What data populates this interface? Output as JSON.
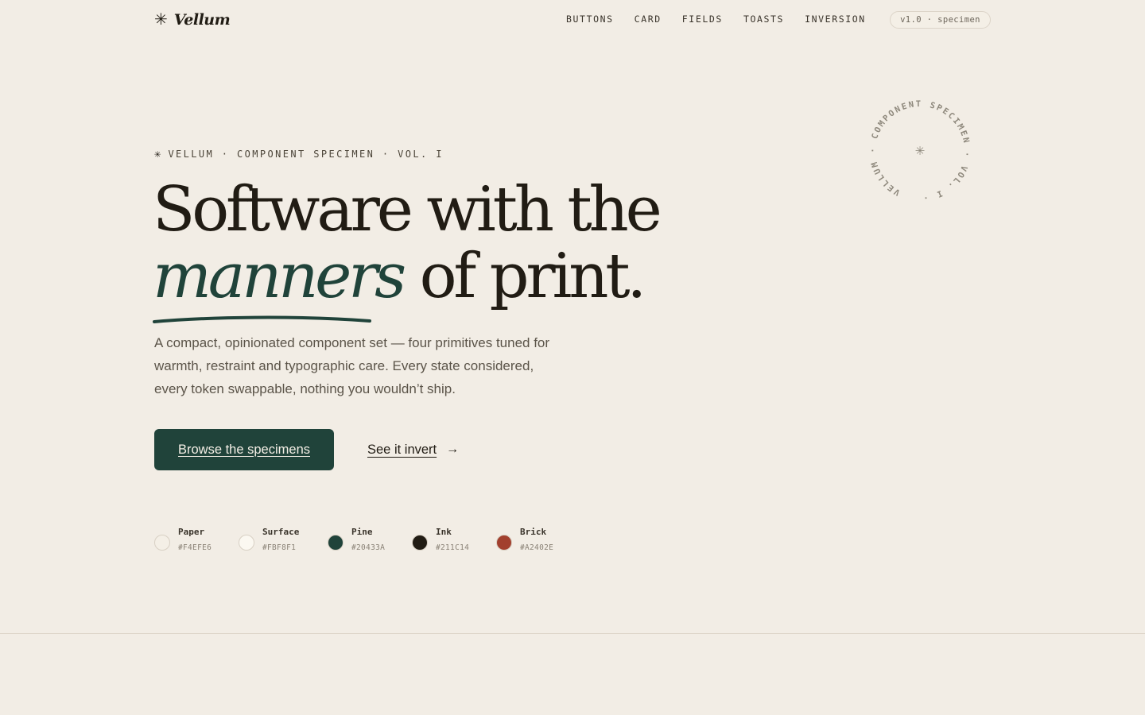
{
  "header": {
    "brand_mark": "✳",
    "brand_name": "Vellum",
    "nav": [
      "BUTTONS",
      "CARD",
      "FIELDS",
      "TOASTS",
      "INVERSION"
    ],
    "version_badge": "v1.0 · specimen"
  },
  "hero": {
    "eyebrow_mark": "✳",
    "eyebrow": "VELLUM · COMPONENT SPECIMEN · VOL. I",
    "headline_line1": "Software with the",
    "headline_accent": "manners",
    "headline_rest": " of print.",
    "lede": "A compact, opinionated component set — four primitives tuned for warmth, restraint and typographic care. Every state considered, every token swappable, nothing you wouldn’t ship.",
    "primary_cta": "Browse the specimens",
    "secondary_cta": "See it invert",
    "secondary_arrow": "→"
  },
  "seal": {
    "text": "VELLUM · COMPONENT SPECIMEN · VOL. I · ",
    "center_mark": "✳"
  },
  "swatches": [
    {
      "name": "Paper",
      "hex": "#F4EFE6"
    },
    {
      "name": "Surface",
      "hex": "#FBF8F1"
    },
    {
      "name": "Pine",
      "hex": "#20433A"
    },
    {
      "name": "Ink",
      "hex": "#211C14"
    },
    {
      "name": "Brick",
      "hex": "#A2402E"
    }
  ],
  "colors": {
    "background": "#F2EDE5",
    "pine": "#20433A",
    "ink": "#211C14"
  }
}
